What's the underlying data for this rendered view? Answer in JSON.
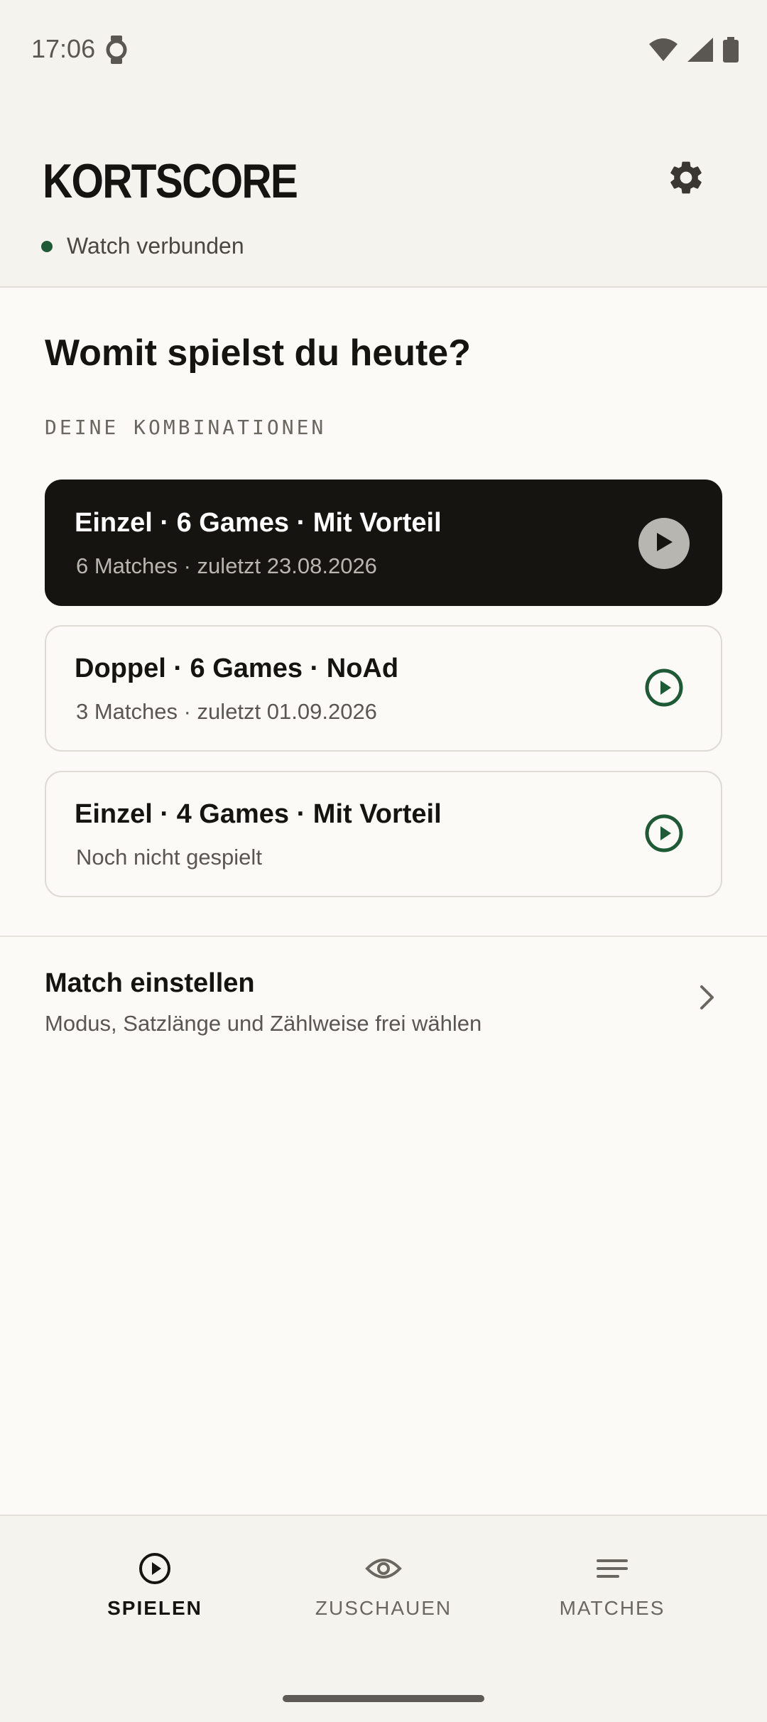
{
  "status_bar": {
    "time": "17:06",
    "icons": [
      "watch-icon",
      "wifi-icon",
      "signal-icon",
      "battery-icon"
    ]
  },
  "header": {
    "title": "KORTSCORE",
    "watch_status": "Watch verbunden",
    "icons": [
      "gear-icon"
    ]
  },
  "main": {
    "question": "Womit spielst du heute?",
    "section_label": "DEINE KOMBINATIONEN",
    "combinations": [
      {
        "title": "Einzel · 6 Games · Mit Vorteil",
        "subtitle": "6 Matches · zuletzt 23.08.2026",
        "active": true
      },
      {
        "title": "Doppel · 6 Games · NoAd",
        "subtitle": "3 Matches · zuletzt 01.09.2026",
        "active": false
      },
      {
        "title": "Einzel · 4 Games · Mit Vorteil",
        "subtitle": "Noch nicht gespielt",
        "active": false
      }
    ],
    "match_setup": {
      "title": "Match einstellen",
      "subtitle": "Modus, Satzlänge und Zählweise frei wählen"
    }
  },
  "bottom_nav": {
    "items": [
      {
        "label": "SPIELEN",
        "icon": "play-circle-icon",
        "active": true
      },
      {
        "label": "ZUSCHAUEN",
        "icon": "eye-icon",
        "active": false
      },
      {
        "label": "MATCHES",
        "icon": "list-icon",
        "active": false
      }
    ]
  },
  "colors": {
    "accent": "#1f5a36",
    "ink": "#161411",
    "background": "#f5f3ee",
    "surface": "#fbfaf7"
  }
}
